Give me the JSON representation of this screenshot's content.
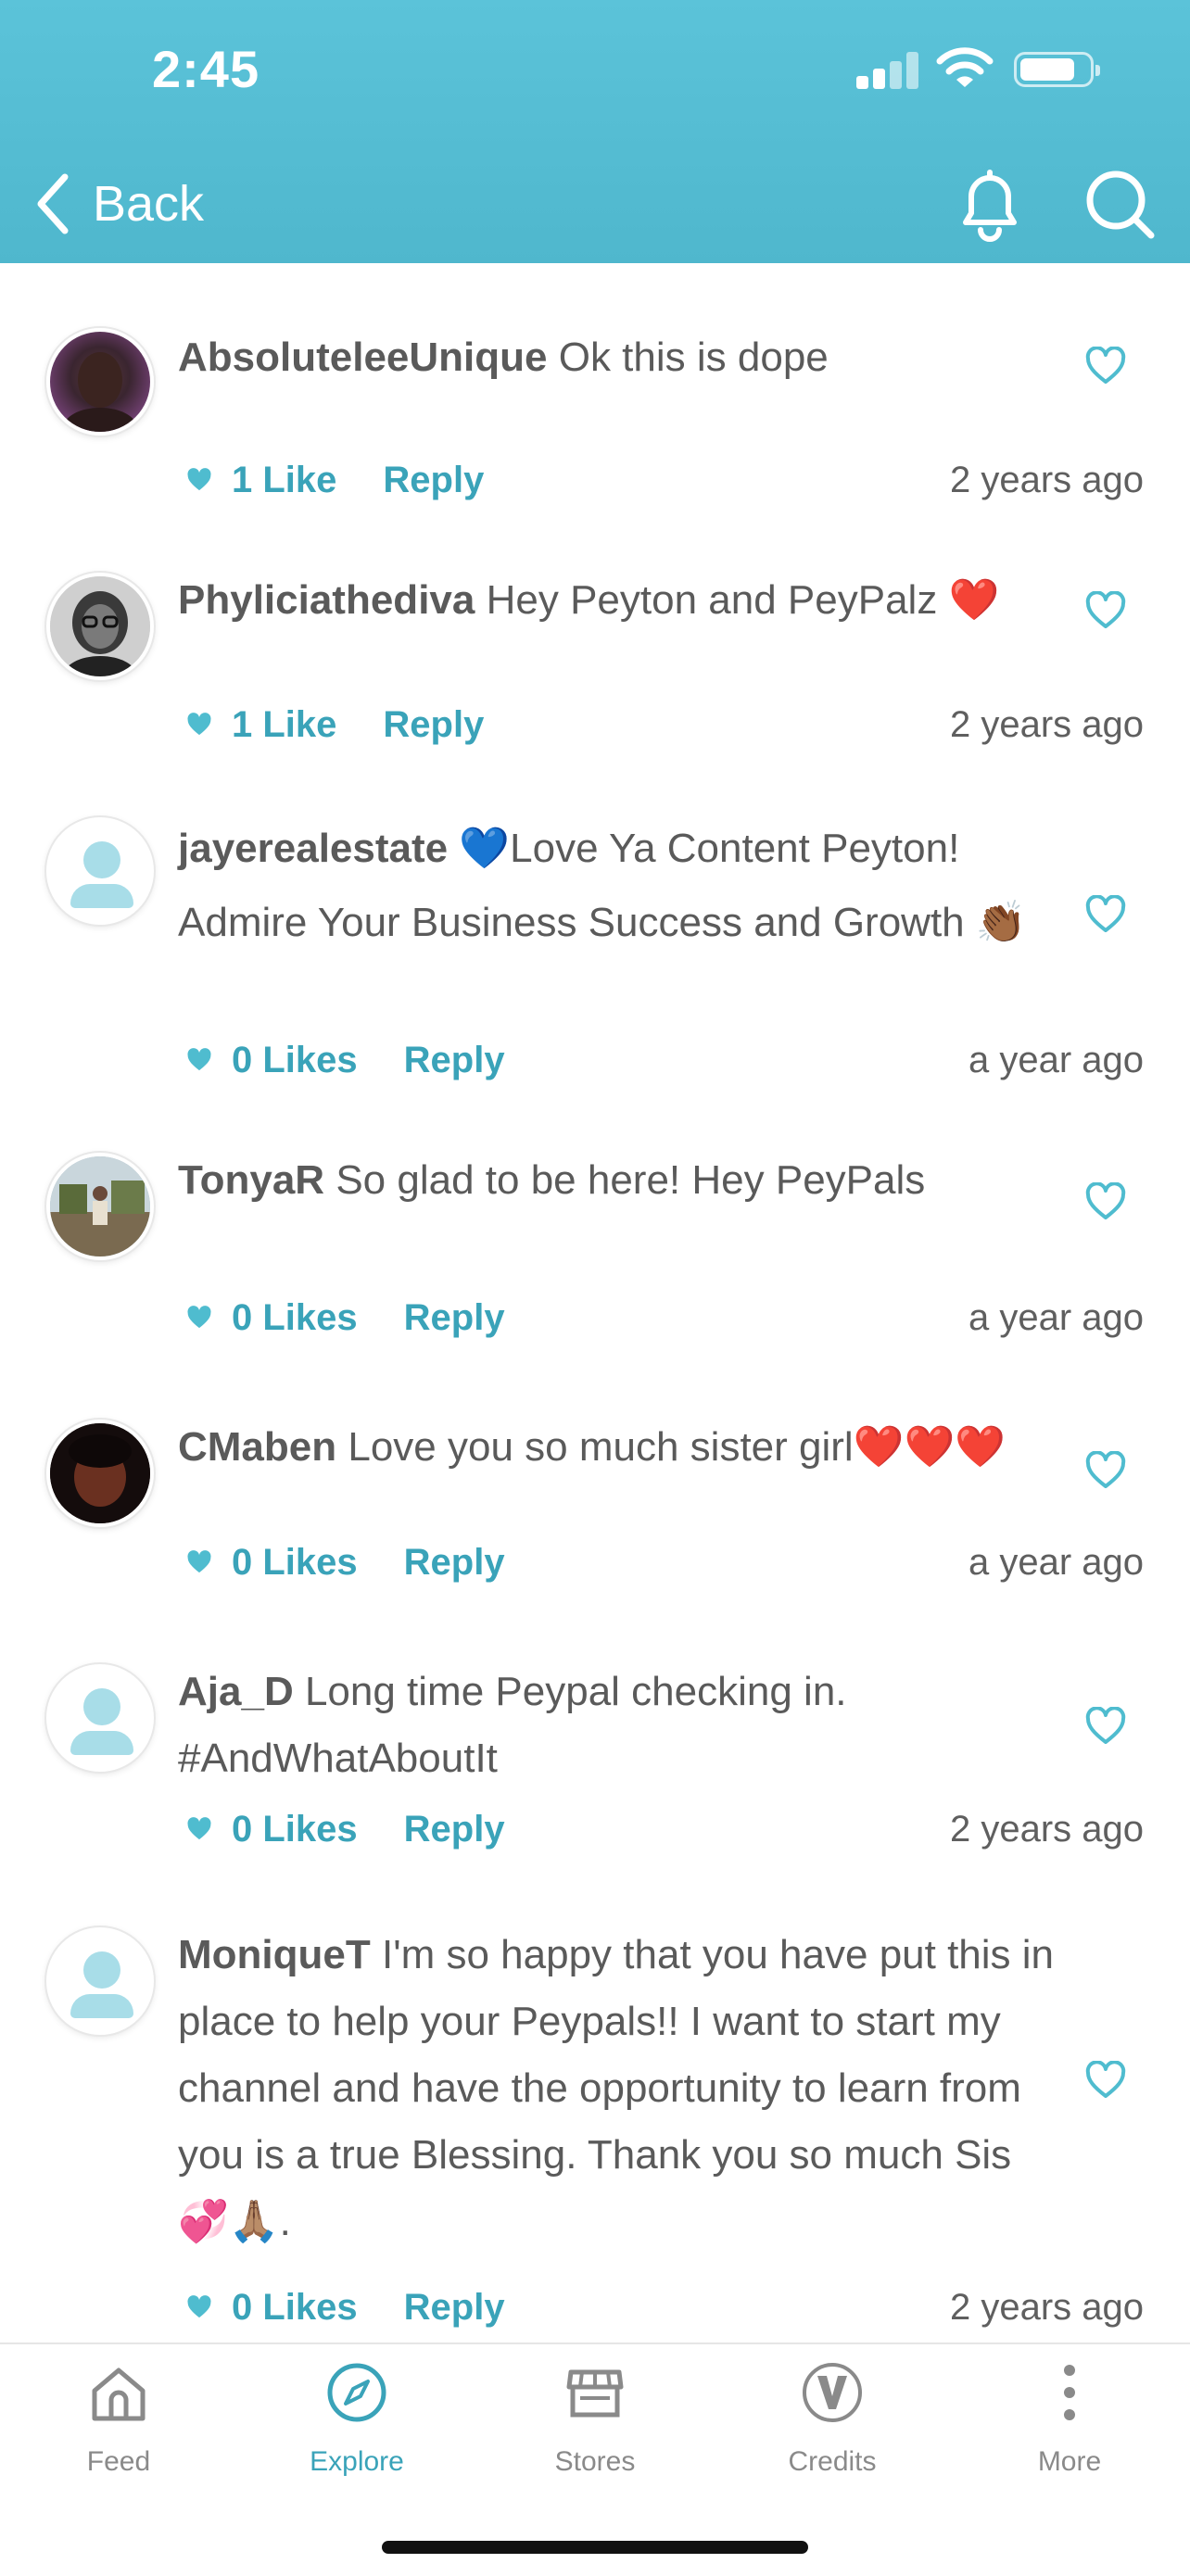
{
  "status_bar": {
    "time": "2:45"
  },
  "header": {
    "back_label": "Back"
  },
  "comments": [
    {
      "username": "AbsoluteleeUnique",
      "text": "Ok this is dope",
      "likes": "1 Like",
      "reply": "Reply",
      "time": "2 years ago",
      "avatar": "photo"
    },
    {
      "username": "Phyliciathediva",
      "text": "Hey Peyton and PeyPalz ❤️",
      "likes": "1 Like",
      "reply": "Reply",
      "time": "2 years ago",
      "avatar": "photo"
    },
    {
      "username": "jayerealestate",
      "text": "💙Love Ya Content Peyton! Admire Your Business Success and Growth 👏🏾",
      "likes": "0 Likes",
      "reply": "Reply",
      "time": "a year ago",
      "avatar": "default"
    },
    {
      "username": "TonyaR",
      "text": "So glad to be here! Hey PeyPals",
      "likes": "0 Likes",
      "reply": "Reply",
      "time": "a year ago",
      "avatar": "photo"
    },
    {
      "username": "CMaben",
      "text": "Love you so much sister girl❤️❤️❤️",
      "likes": "0 Likes",
      "reply": "Reply",
      "time": "a year ago",
      "avatar": "photo"
    },
    {
      "username": "Aja_D",
      "text": "Long time Peypal checking in. #AndWhatAboutIt",
      "likes": "0 Likes",
      "reply": "Reply",
      "time": "2 years ago",
      "avatar": "default"
    },
    {
      "username": "MoniqueT",
      "text": "I'm so happy that you have put this in place to help your Peypals!! I want to start my channel and have the opportunity to learn from you is a true Blessing. Thank you so much Sis💞🙏🏽.",
      "likes": "0 Likes",
      "reply": "Reply",
      "time": "2 years ago",
      "avatar": "default"
    }
  ],
  "tabbar": {
    "tabs": [
      {
        "label": "Feed",
        "icon": "home-icon"
      },
      {
        "label": "Explore",
        "icon": "compass-icon",
        "active": true
      },
      {
        "label": "Stores",
        "icon": "store-icon"
      },
      {
        "label": "Credits",
        "icon": "credits-v-icon"
      },
      {
        "label": "More",
        "icon": "more-vertical-icon"
      }
    ]
  },
  "colors": {
    "accent": "#3aa3b9",
    "header": "#53bbd1",
    "text": "#5a5a5a"
  }
}
